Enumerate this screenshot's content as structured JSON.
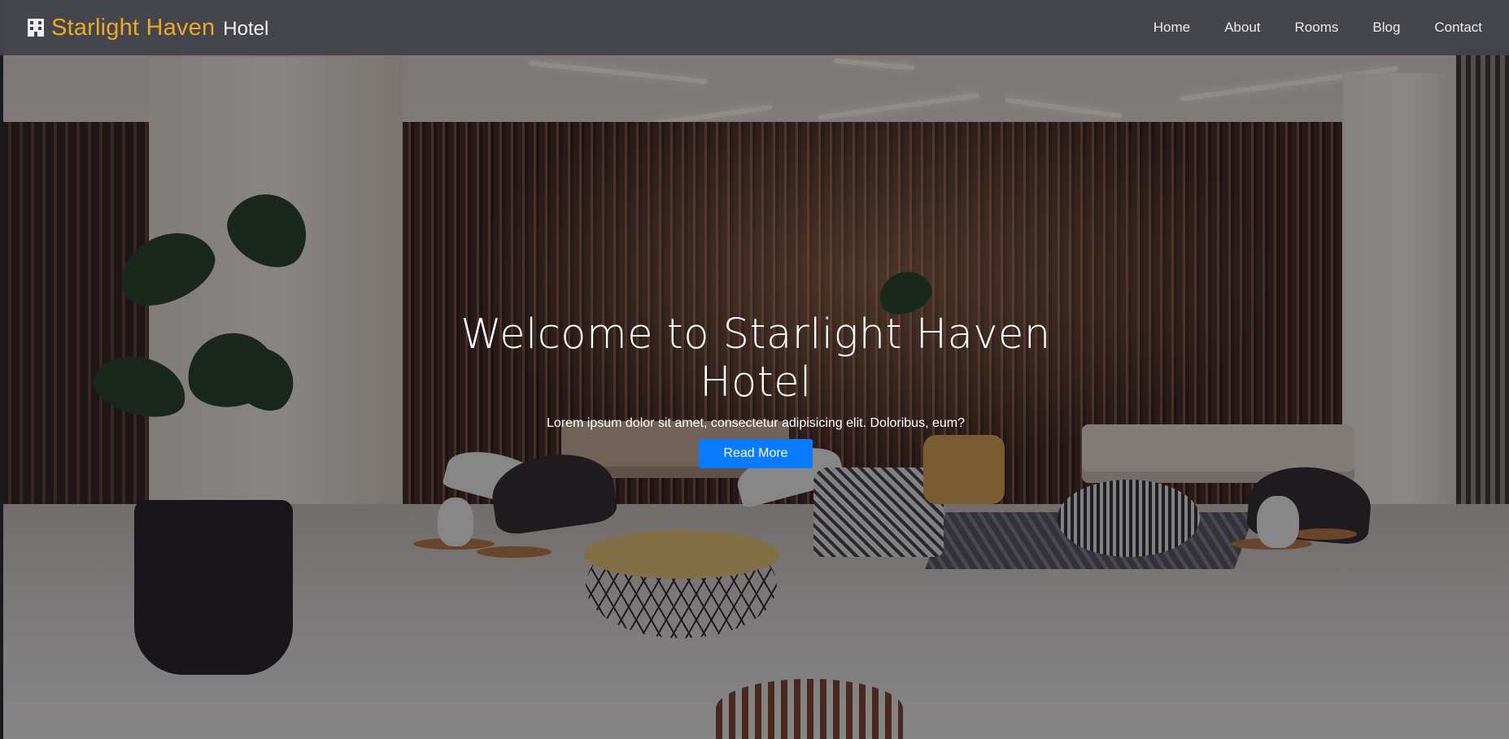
{
  "navbar": {
    "brand_icon": "hotel-building-icon",
    "brand_name": "Starlight Haven",
    "brand_suffix": "Hotel",
    "links": [
      {
        "label": "Home"
      },
      {
        "label": "About"
      },
      {
        "label": "Rooms"
      },
      {
        "label": "Blog"
      },
      {
        "label": "Contact"
      }
    ]
  },
  "hero": {
    "title": "Welcome to Starlight Haven Hotel",
    "subtitle": "Lorem ipsum dolor sit amet, consectetur adipisicing elit. Doloribus, eum?",
    "cta_label": "Read More",
    "background_image": "hotel-lobby-photo"
  },
  "colors": {
    "brand_accent": "#e9a92a",
    "cta_button": "#0a7bff",
    "navbar_bg": "#42444a"
  }
}
